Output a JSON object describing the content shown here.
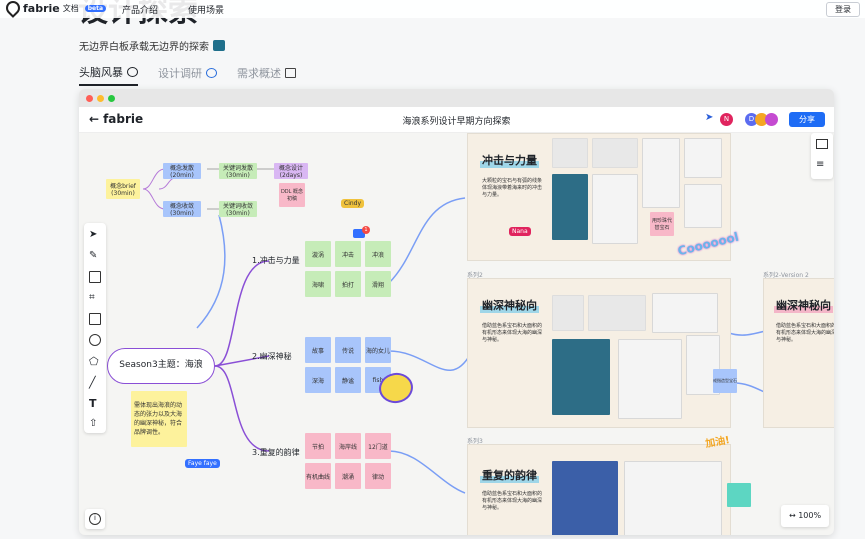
{
  "site": {
    "brand": "fabrie",
    "brand_sub": "文档",
    "beta": "beta",
    "nav": [
      "产品介绍",
      "使用场景"
    ],
    "login": "登录",
    "hero_title": "设计探索",
    "subtitle": "无边界白板承载无边界的探索",
    "tabs": [
      {
        "label": "头脑风暴",
        "active": true
      },
      {
        "label": "设计调研",
        "active": false
      },
      {
        "label": "需求概述",
        "active": false
      }
    ]
  },
  "app": {
    "logo": "fabrie",
    "doc_title": "海浪系列设计早期方向探索",
    "share": "分享",
    "avatars": [
      {
        "letter": "N",
        "color": "#e0245e"
      },
      {
        "letter": "D",
        "color": "#5b6cf0"
      },
      {
        "letter": "",
        "color": "#f5a623"
      },
      {
        "letter": "",
        "color": "#c54bd1"
      }
    ],
    "zoom": "100%",
    "comment_badge": "1"
  },
  "mindmap": {
    "center": "Season3主题：海浪",
    "branches": [
      {
        "label": "1.冲击与力量",
        "stickies": [
          "漩涡",
          "冲击",
          "冲浪",
          "海啸",
          "拍打",
          "滑翔"
        ]
      },
      {
        "label": "2.幽深神秘",
        "stickies": [
          "故事",
          "传说",
          "海的女儿",
          "深海",
          "静谧",
          "fish"
        ]
      },
      {
        "label": "3.重复的韵律",
        "stickies": [
          "节拍",
          "海岸线",
          "12门道",
          "有机曲线",
          "潮涌",
          "律动"
        ]
      }
    ],
    "plan": {
      "brief": "概念brief\n(30min)",
      "s1": "概念发散\n(20min)",
      "s2": "概念收敛\n(30min)",
      "s3": "关键词发散\n(30min)",
      "s4": "关键词收敛\n(30min)",
      "s5": "概念设计\n(2days)",
      "s6": "DDL\n概念初稿"
    },
    "note": "需体现出海浪的动态的张力以及大海的幽深神秘，符合品牌调性。",
    "cursors": [
      "Cindy",
      "Nana",
      "Faye faye"
    ]
  },
  "frames": [
    {
      "label": "",
      "title": "冲击与力量",
      "desc": "大颗粒的宝石与有弧的线条体现海浪带着海来时的冲击与力量。"
    },
    {
      "label": "系列2",
      "title": "幽深神秘向",
      "desc": "借助蓝色系宝石和大面积的有机形态来体现大海的幽深与神秘。"
    },
    {
      "label": "系列3",
      "title": "重复的韵律",
      "desc": "借助蓝色系宝石和大面积的有机形态来体现大海的幽深与神秘。"
    },
    {
      "label": "系列2-Version 2",
      "title": "幽深神秘向",
      "desc": "借助蓝色系宝石和大面积的有机形态来体现大海的幽深与神秘。"
    }
  ],
  "side_sticky": "戒指造型宝石",
  "pink_sticky": "用珍珠代替宝石",
  "stickers": [
    "Cooooool",
    "加油!"
  ]
}
